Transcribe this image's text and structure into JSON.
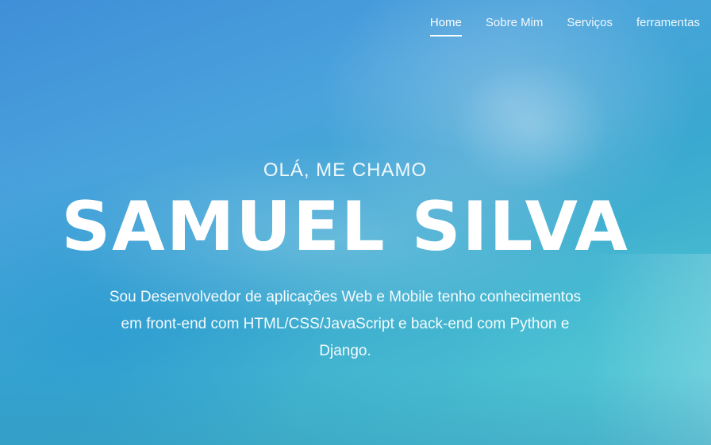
{
  "nav": {
    "items": [
      {
        "label": "Home",
        "active": true
      },
      {
        "label": "Sobre Mim",
        "active": false
      },
      {
        "label": "Serviços",
        "active": false
      },
      {
        "label": "ferramentas",
        "active": false
      }
    ]
  },
  "hero": {
    "greeting": "OLÁ, ME CHAMO",
    "name": "SAMUEL SILVA",
    "description": "Sou Desenvolvedor de aplicações Web e Mobile tenho conhecimentos em front-end com HTML/CSS/JavaScript e back-end com Python e Django."
  },
  "colors": {
    "overlay": "#3fa6d8",
    "text": "#ffffff"
  }
}
